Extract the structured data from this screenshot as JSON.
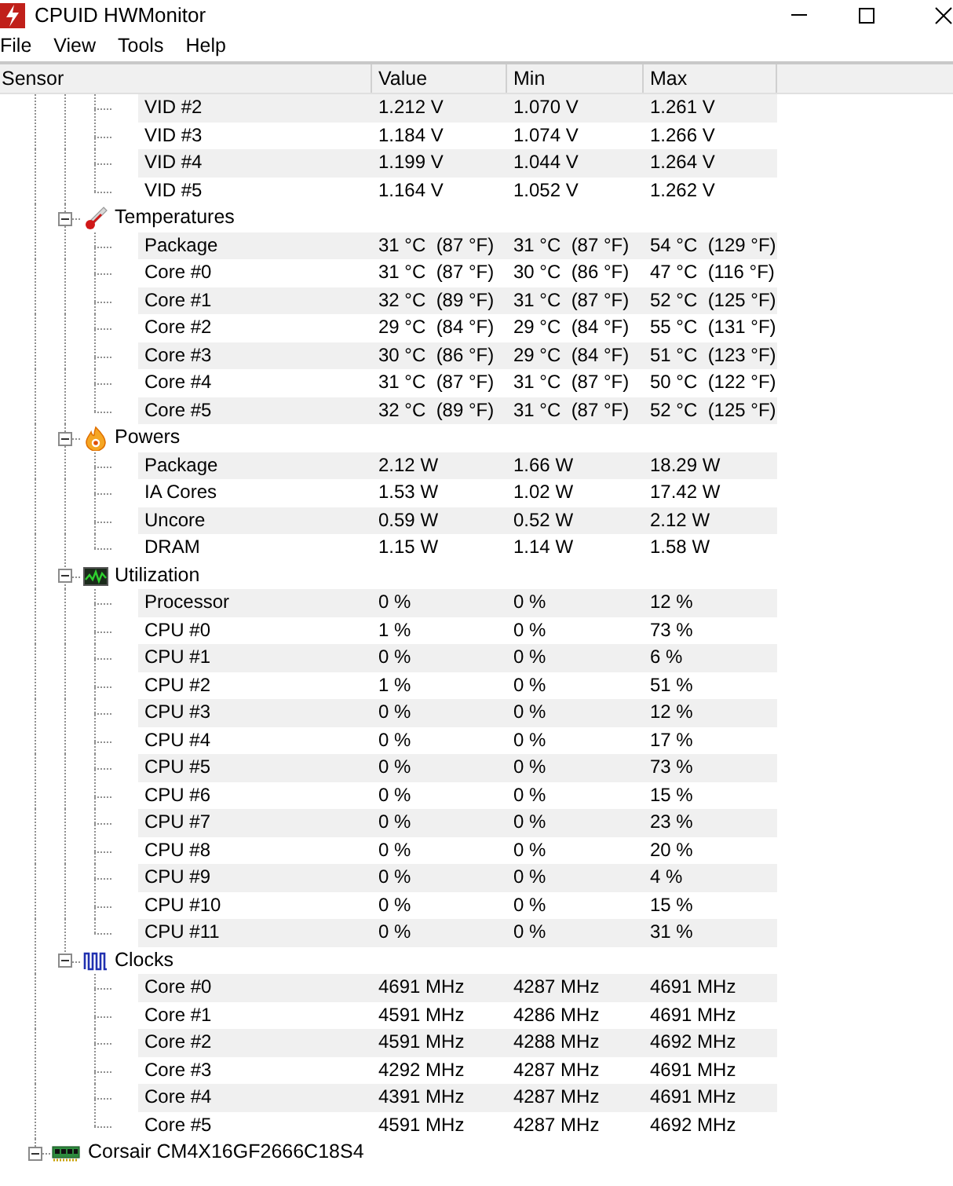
{
  "window": {
    "title": "CPUID HWMonitor"
  },
  "menu": [
    "File",
    "View",
    "Tools",
    "Help"
  ],
  "columns": [
    "Sensor",
    "Value",
    "Min",
    "Max"
  ],
  "devices": [
    {
      "groups": [
        {
          "sensors": [
            {
              "name": "VID #2",
              "value": "1.212 V",
              "min": "1.070 V",
              "max": "1.261 V"
            },
            {
              "name": "VID #3",
              "value": "1.184 V",
              "min": "1.074 V",
              "max": "1.266 V"
            },
            {
              "name": "VID #4",
              "value": "1.199 V",
              "min": "1.044 V",
              "max": "1.264 V"
            },
            {
              "name": "VID #5",
              "value": "1.164 V",
              "min": "1.052 V",
              "max": "1.262 V"
            }
          ]
        },
        {
          "label": "Temperatures",
          "kind": "temperature",
          "expanded": true,
          "sensors": [
            {
              "name": "Package",
              "value": "31 °C  (87 °F)",
              "min": "31 °C  (87 °F)",
              "max": "54 °C  (129 °F)"
            },
            {
              "name": "Core #0",
              "value": "31 °C  (87 °F)",
              "min": "30 °C  (86 °F)",
              "max": "47 °C  (116 °F)"
            },
            {
              "name": "Core #1",
              "value": "32 °C  (89 °F)",
              "min": "31 °C  (87 °F)",
              "max": "52 °C  (125 °F)"
            },
            {
              "name": "Core #2",
              "value": "29 °C  (84 °F)",
              "min": "29 °C  (84 °F)",
              "max": "55 °C  (131 °F)"
            },
            {
              "name": "Core #3",
              "value": "30 °C  (86 °F)",
              "min": "29 °C  (84 °F)",
              "max": "51 °C  (123 °F)"
            },
            {
              "name": "Core #4",
              "value": "31 °C  (87 °F)",
              "min": "31 °C  (87 °F)",
              "max": "50 °C  (122 °F)"
            },
            {
              "name": "Core #5",
              "value": "32 °C  (89 °F)",
              "min": "31 °C  (87 °F)",
              "max": "52 °C  (125 °F)"
            }
          ]
        },
        {
          "label": "Powers",
          "kind": "power",
          "expanded": true,
          "sensors": [
            {
              "name": "Package",
              "value": "2.12 W",
              "min": "1.66 W",
              "max": "18.29 W"
            },
            {
              "name": "IA Cores",
              "value": "1.53 W",
              "min": "1.02 W",
              "max": "17.42 W"
            },
            {
              "name": "Uncore",
              "value": "0.59 W",
              "min": "0.52 W",
              "max": "2.12 W"
            },
            {
              "name": "DRAM",
              "value": "1.15 W",
              "min": "1.14 W",
              "max": "1.58 W"
            }
          ]
        },
        {
          "label": "Utilization",
          "kind": "utilization",
          "expanded": true,
          "sensors": [
            {
              "name": "Processor",
              "value": "0 %",
              "min": "0 %",
              "max": "12 %"
            },
            {
              "name": "CPU #0",
              "value": "1 %",
              "min": "0 %",
              "max": "73 %"
            },
            {
              "name": "CPU #1",
              "value": "0 %",
              "min": "0 %",
              "max": "6 %"
            },
            {
              "name": "CPU #2",
              "value": "1 %",
              "min": "0 %",
              "max": "51 %"
            },
            {
              "name": "CPU #3",
              "value": "0 %",
              "min": "0 %",
              "max": "12 %"
            },
            {
              "name": "CPU #4",
              "value": "0 %",
              "min": "0 %",
              "max": "17 %"
            },
            {
              "name": "CPU #5",
              "value": "0 %",
              "min": "0 %",
              "max": "73 %"
            },
            {
              "name": "CPU #6",
              "value": "0 %",
              "min": "0 %",
              "max": "15 %"
            },
            {
              "name": "CPU #7",
              "value": "0 %",
              "min": "0 %",
              "max": "23 %"
            },
            {
              "name": "CPU #8",
              "value": "0 %",
              "min": "0 %",
              "max": "20 %"
            },
            {
              "name": "CPU #9",
              "value": "0 %",
              "min": "0 %",
              "max": "4 %"
            },
            {
              "name": "CPU #10",
              "value": "0 %",
              "min": "0 %",
              "max": "15 %"
            },
            {
              "name": "CPU #11",
              "value": "0 %",
              "min": "0 %",
              "max": "31 %"
            }
          ]
        },
        {
          "label": "Clocks",
          "kind": "clock",
          "expanded": true,
          "sensors": [
            {
              "name": "Core #0",
              "value": "4691 MHz",
              "min": "4287 MHz",
              "max": "4691 MHz"
            },
            {
              "name": "Core #1",
              "value": "4591 MHz",
              "min": "4286 MHz",
              "max": "4691 MHz"
            },
            {
              "name": "Core #2",
              "value": "4591 MHz",
              "min": "4288 MHz",
              "max": "4692 MHz"
            },
            {
              "name": "Core #3",
              "value": "4292 MHz",
              "min": "4287 MHz",
              "max": "4691 MHz"
            },
            {
              "name": "Core #4",
              "value": "4391 MHz",
              "min": "4287 MHz",
              "max": "4691 MHz"
            },
            {
              "name": "Core #5",
              "value": "4591 MHz",
              "min": "4287 MHz",
              "max": "4692 MHz"
            }
          ]
        }
      ]
    },
    {
      "label": "Corsair CM4X16GF2666C18S4",
      "kind": "memory",
      "expanded": true
    }
  ]
}
